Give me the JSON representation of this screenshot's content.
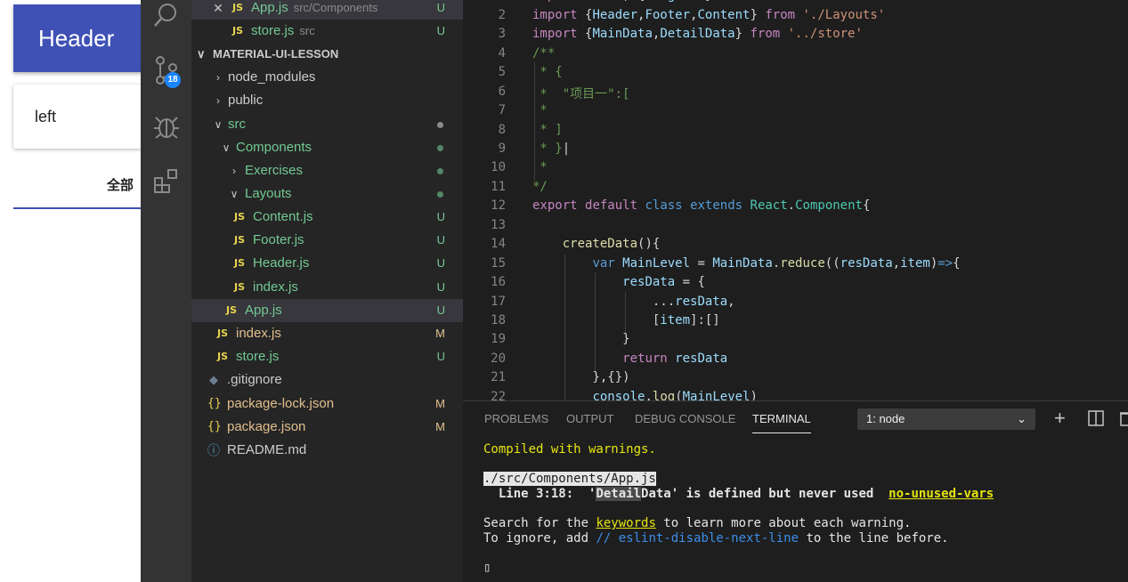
{
  "preview": {
    "header_title": "Header",
    "card_text": "left",
    "tab_label": "全部"
  },
  "activity_bar": {
    "scm_badge": "18",
    "icons": [
      "search-icon",
      "source-control-icon",
      "debug-icon",
      "extensions-icon"
    ]
  },
  "explorer": {
    "open_editors": [
      {
        "name": "App.js",
        "desc": "src/Components",
        "status": "U",
        "active": true
      },
      {
        "name": "store.js",
        "desc": "src",
        "status": "U"
      }
    ],
    "project_title": "MATERIAL-UI-LESSON",
    "tree": [
      {
        "name": "node_modules",
        "type": "folder",
        "expanded": false
      },
      {
        "name": "public",
        "type": "folder",
        "expanded": false
      },
      {
        "name": "src",
        "type": "folder",
        "expanded": true
      },
      {
        "name": "Components",
        "type": "folder",
        "expanded": true
      },
      {
        "name": "Exercises",
        "type": "folder",
        "expanded": false
      },
      {
        "name": "Layouts",
        "type": "folder",
        "expanded": true
      },
      {
        "name": "Content.js",
        "type": "js",
        "status": "U"
      },
      {
        "name": "Footer.js",
        "type": "js",
        "status": "U"
      },
      {
        "name": "Header.js",
        "type": "js",
        "status": "U"
      },
      {
        "name": "index.js",
        "type": "js",
        "status": "U"
      },
      {
        "name": "App.js",
        "type": "js",
        "status": "U",
        "selected": true
      },
      {
        "name": "index.js",
        "type": "js",
        "status": "M"
      },
      {
        "name": "store.js",
        "type": "js",
        "status": "U"
      },
      {
        "name": ".gitignore",
        "type": "file"
      },
      {
        "name": "package-lock.json",
        "type": "json",
        "status": "M"
      },
      {
        "name": "package.json",
        "type": "json",
        "status": "M"
      },
      {
        "name": "README.md",
        "type": "info"
      }
    ]
  },
  "editor": {
    "line_numbers": [
      "2",
      "3",
      "4",
      "5",
      "6",
      "7",
      "8",
      "9",
      "10",
      "11",
      "12",
      "13",
      "14",
      "15",
      "16",
      "17",
      "18",
      "19",
      "20",
      "21",
      "22"
    ],
    "top_partial": "import React, {Fragment} from 'react'"
  },
  "panel": {
    "tabs": [
      "PROBLEMS",
      "OUTPUT",
      "DEBUG CONSOLE",
      "TERMINAL"
    ],
    "active_tab": "TERMINAL",
    "terminal_select": "1: node",
    "lines": {
      "compiled": "Compiled with warnings.",
      "file": "./src/Components/App.js",
      "warn_prefix": "  Line 3:18:  '",
      "warn_hl": "Detail",
      "warn_rest": "Data' is defined but never used  ",
      "warn_rule": "no-unused-vars",
      "search_a": "Search for the ",
      "search_kw": "keywords",
      "search_b": " to learn more about each warning.",
      "ignore_a": "To ignore, add ",
      "ignore_cmt": "// eslint-disable-next-line",
      "ignore_b": " to the line before.",
      "cursor": "▯"
    }
  },
  "colors": {
    "preview_header": "#3f51b5",
    "activity_bar": "#333333",
    "sidebar": "#252526",
    "editor_bg": "#1e1e1e",
    "badge": "#1a85ff"
  }
}
